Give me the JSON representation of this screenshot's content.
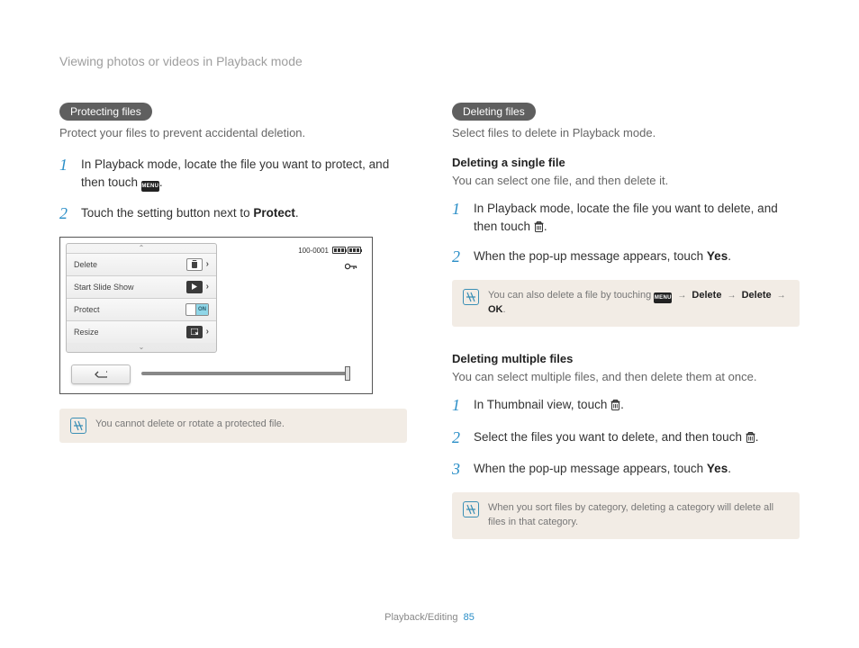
{
  "header": {
    "title": "Viewing photos or videos in Playback mode"
  },
  "left": {
    "pill": "Protecting files",
    "intro": "Protect your files to prevent accidental deletion.",
    "step1_prefix": "In Playback mode, locate the file you want to protect, and then touch ",
    "step1_suffix": ".",
    "step2_prefix": "Touch the setting button next to ",
    "step2_bold": "Protect",
    "step2_suffix": ".",
    "menu_chip": "MENU",
    "ill": {
      "row1": "Delete",
      "row2": "Start Slide Show",
      "row3": "Protect",
      "row4": "Resize",
      "toggle": "ON",
      "counter": "100-0001"
    },
    "note": "You cannot delete or rotate a protected file."
  },
  "right": {
    "pill": "Deleting files",
    "intro": "Select files to delete in Playback mode.",
    "single": {
      "head": "Deleting a single file",
      "desc": "You can select one file, and then delete it.",
      "step1_prefix": "In Playback mode, locate the file you want to delete, and then touch ",
      "step1_suffix": ".",
      "step2_prefix": "When the pop-up message appears, touch ",
      "step2_bold": "Yes",
      "step2_suffix": "."
    },
    "note_single_a": "You can also delete a file by touching ",
    "note_single_b": "Delete",
    "note_single_c": "Delete",
    "ok": "OK",
    "multi": {
      "head": "Deleting multiple files",
      "desc": "You can select multiple files, and then delete them at once.",
      "step1_prefix": "In Thumbnail view, touch ",
      "step1_suffix": ".",
      "step2_prefix": "Select the files you want to delete, and then touch ",
      "step2_suffix": ".",
      "step3_prefix": "When the pop-up message appears, touch ",
      "step3_bold": "Yes",
      "step3_suffix": "."
    },
    "note_multi": "When you sort files by category, deleting a category will delete all files in that category."
  },
  "footer": {
    "section": "Playback/Editing",
    "page": "85"
  }
}
